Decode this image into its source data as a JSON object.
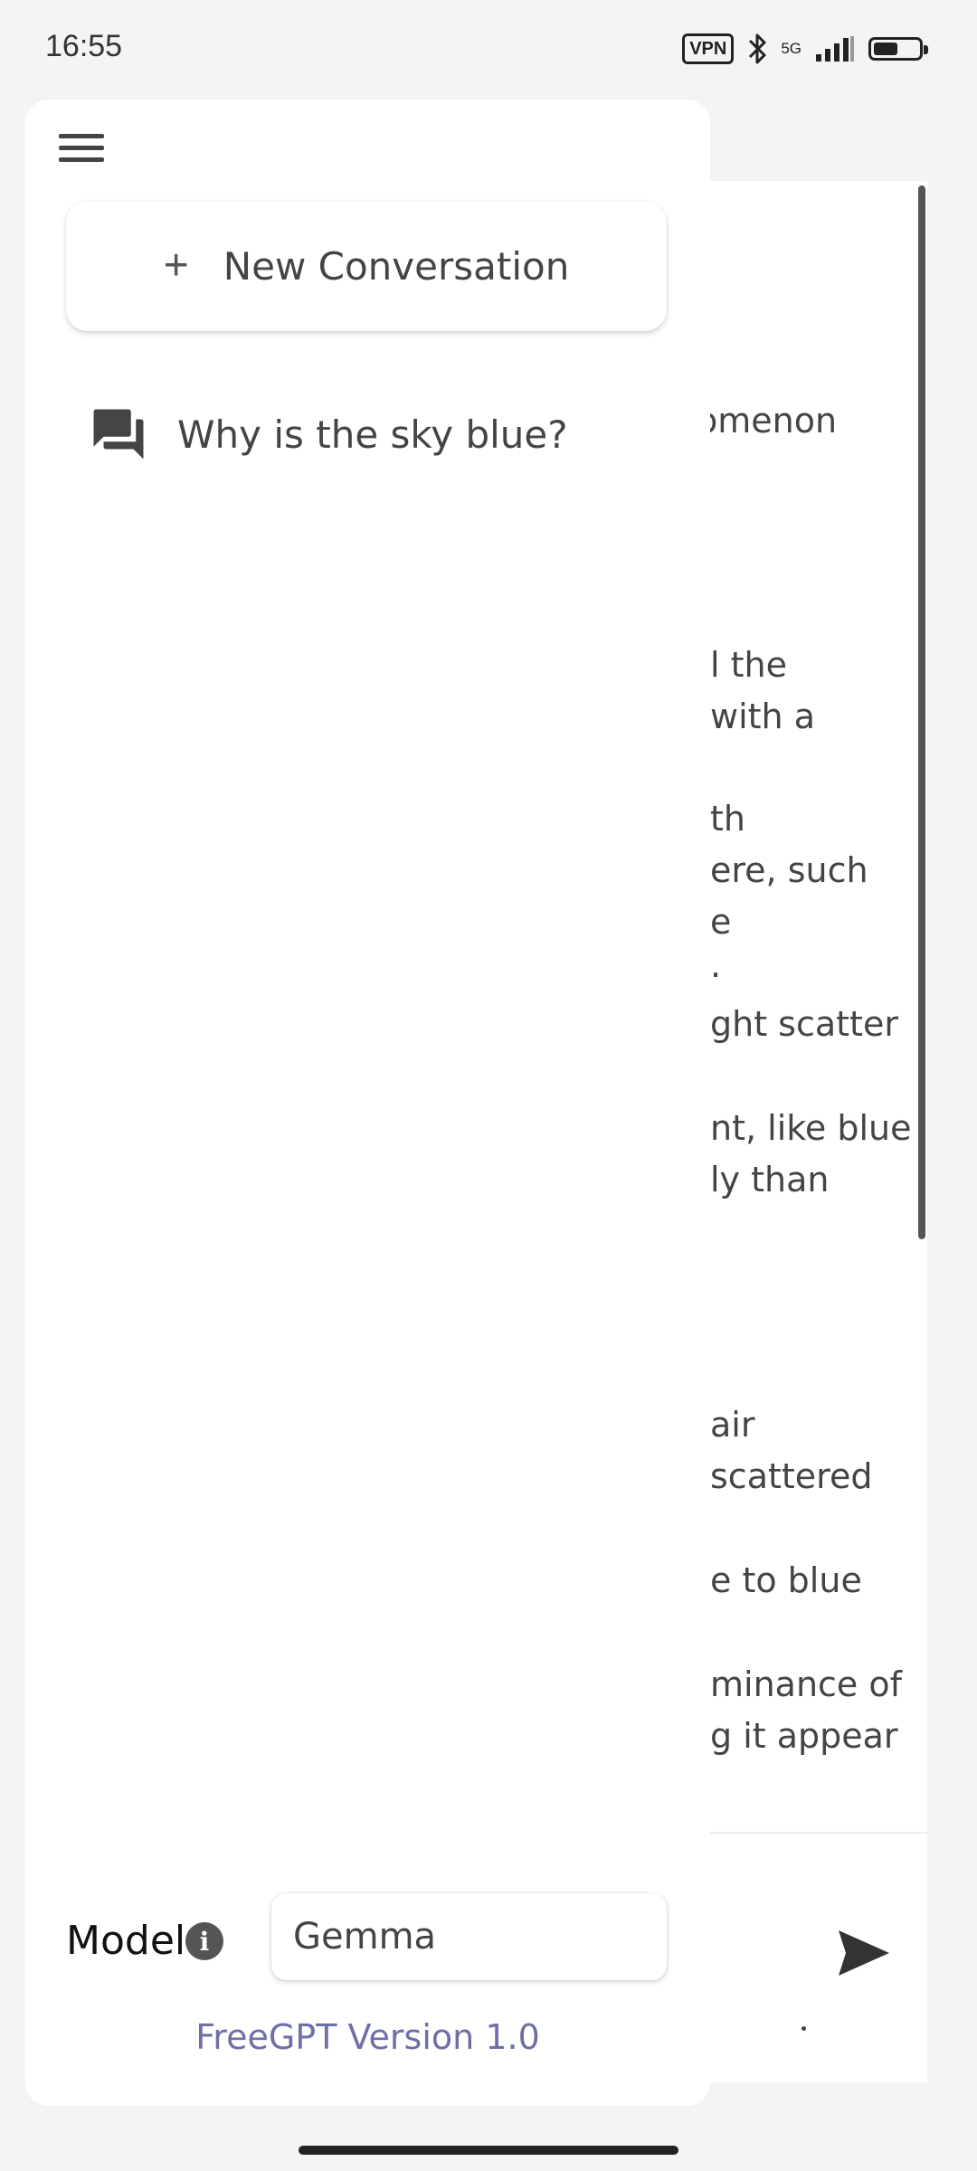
{
  "status_bar": {
    "time": "16:55",
    "vpn": "VPN",
    "network": "5G",
    "battery_level": 0.55
  },
  "drawer": {
    "new_conversation_label": "New Conversation",
    "conversations": [
      "Why is the sky blue?"
    ],
    "model_label": "Model",
    "model_value": "Gemma",
    "version": "FreeGPT Version 1.0"
  },
  "background_chat": {
    "visible_fragments": [
      "omenon",
      "l the",
      " with a",
      "th",
      "ere, such",
      "e",
      ".",
      "ght scatter",
      "nt, like blue",
      "ly than",
      " air",
      " scattered",
      "e to blue",
      "minance of",
      "g it appear"
    ]
  },
  "colors": {
    "background": "#f4f4f4",
    "drawer": "#ffffff",
    "version_text": "#6f6fa8",
    "icon": "#444444"
  },
  "icons": {
    "menu": "hamburger-menu-icon",
    "conversation": "forum-icon",
    "info": "info-icon",
    "send": "send-icon"
  }
}
